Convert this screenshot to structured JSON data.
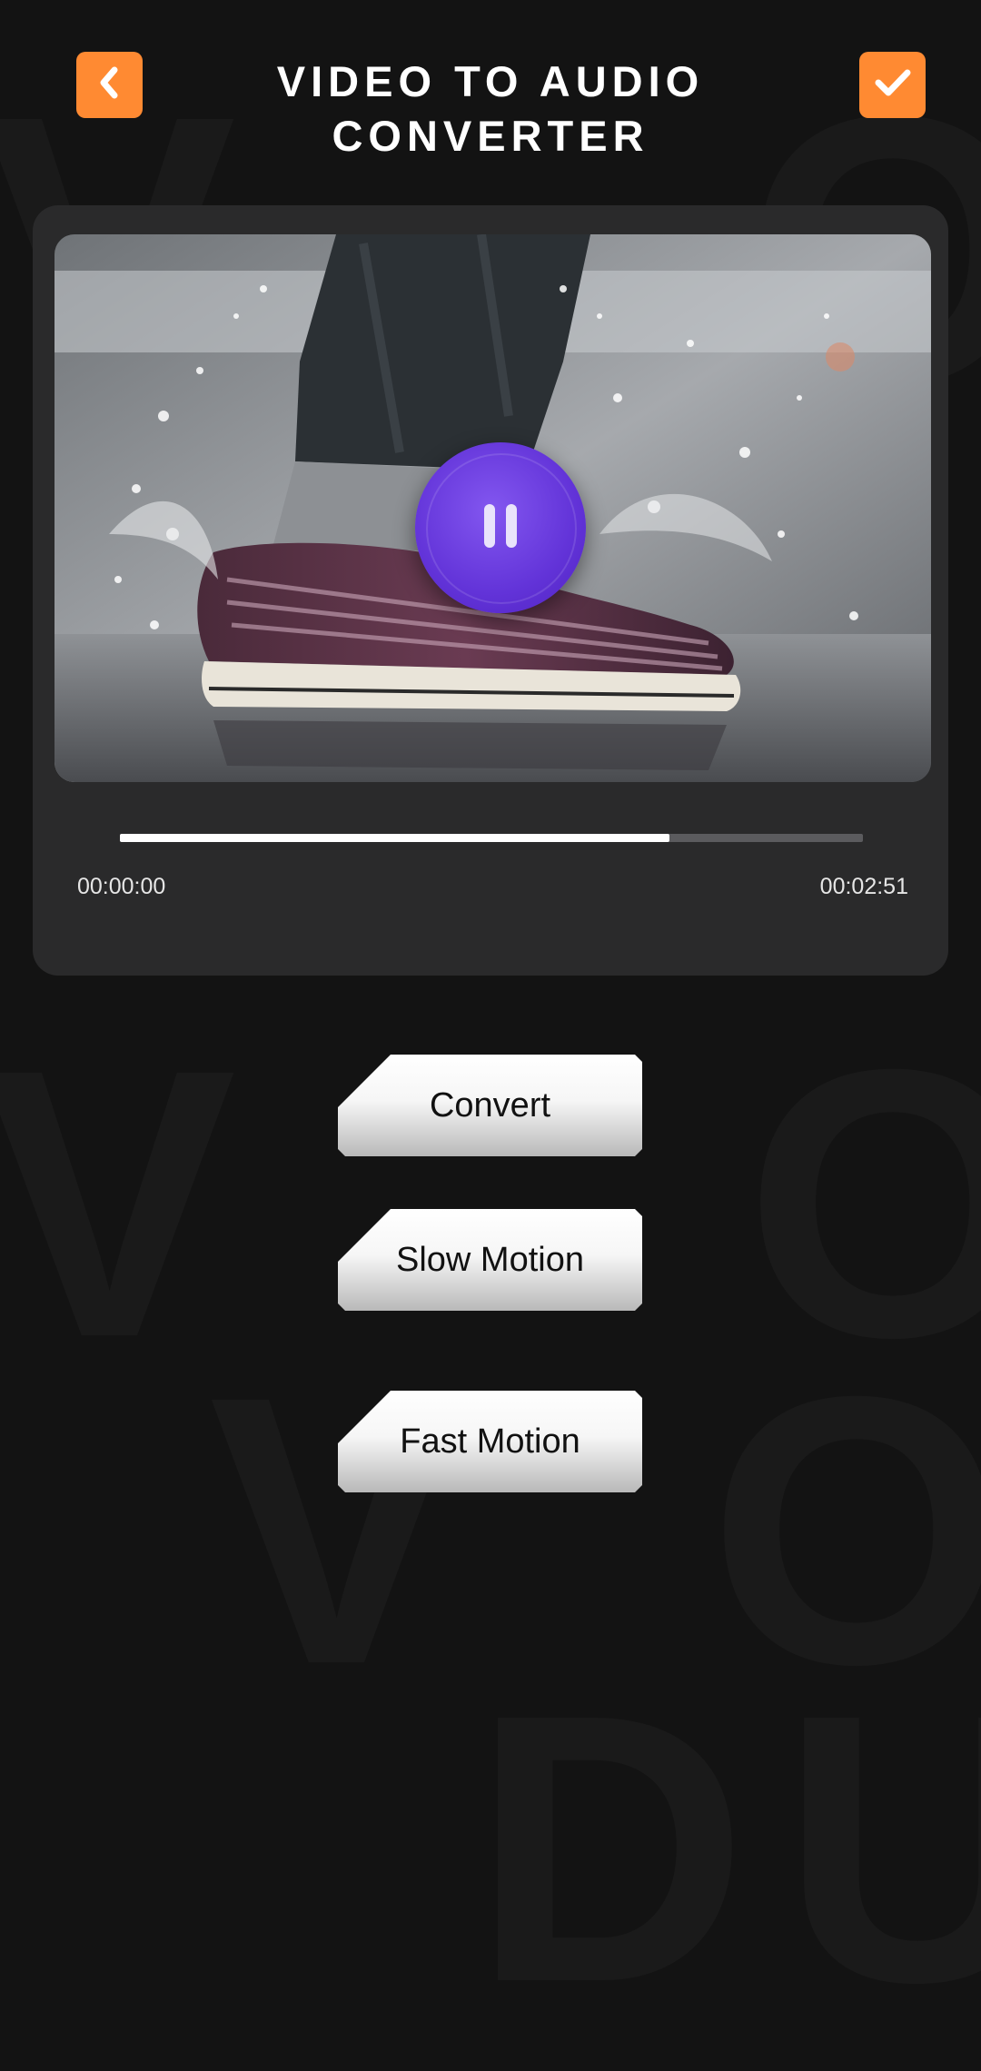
{
  "header": {
    "title_line1": "VIDEO TO AUDIO",
    "title_line2": "CONVERTER",
    "back_icon": "chevron-left-icon",
    "done_icon": "check-icon"
  },
  "player": {
    "state_icon": "pause-icon",
    "progress_fraction": 0.74,
    "time_current": "00:00:00",
    "time_total": "00:02:51"
  },
  "actions": {
    "convert_label": "Convert",
    "slow_motion_label": "Slow Motion",
    "fast_motion_label": "Fast Motion"
  },
  "colors": {
    "accent": "#ff8a32",
    "play_button": "#6a3ce0",
    "background": "#131313",
    "card": "#2a2a2b"
  }
}
